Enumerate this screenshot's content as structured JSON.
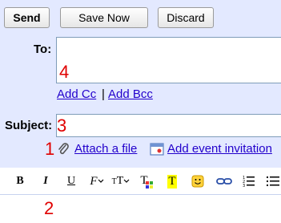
{
  "buttons": {
    "send": "Send",
    "save_now": "Save Now",
    "discard": "Discard"
  },
  "to": {
    "label": "To:",
    "value": ""
  },
  "add_cc": "Add Cc",
  "separator": "|",
  "add_bcc": "Add Bcc",
  "subject": {
    "label": "Subject:",
    "value": ""
  },
  "attach_file": "Attach a file",
  "add_event_invitation": "Add event invitation",
  "markers": {
    "one": "1",
    "two": "2",
    "three": "3",
    "four": "4"
  },
  "toolbar": {
    "bold": "B",
    "italic": "I",
    "underline": "U",
    "font": "F",
    "size": "T",
    "text_color": "T",
    "highlight": "T"
  },
  "colors": {
    "panel": "#e3e9ff",
    "link": "#2200cc",
    "marker": "#e00000",
    "field_border": "#7f9db9"
  }
}
